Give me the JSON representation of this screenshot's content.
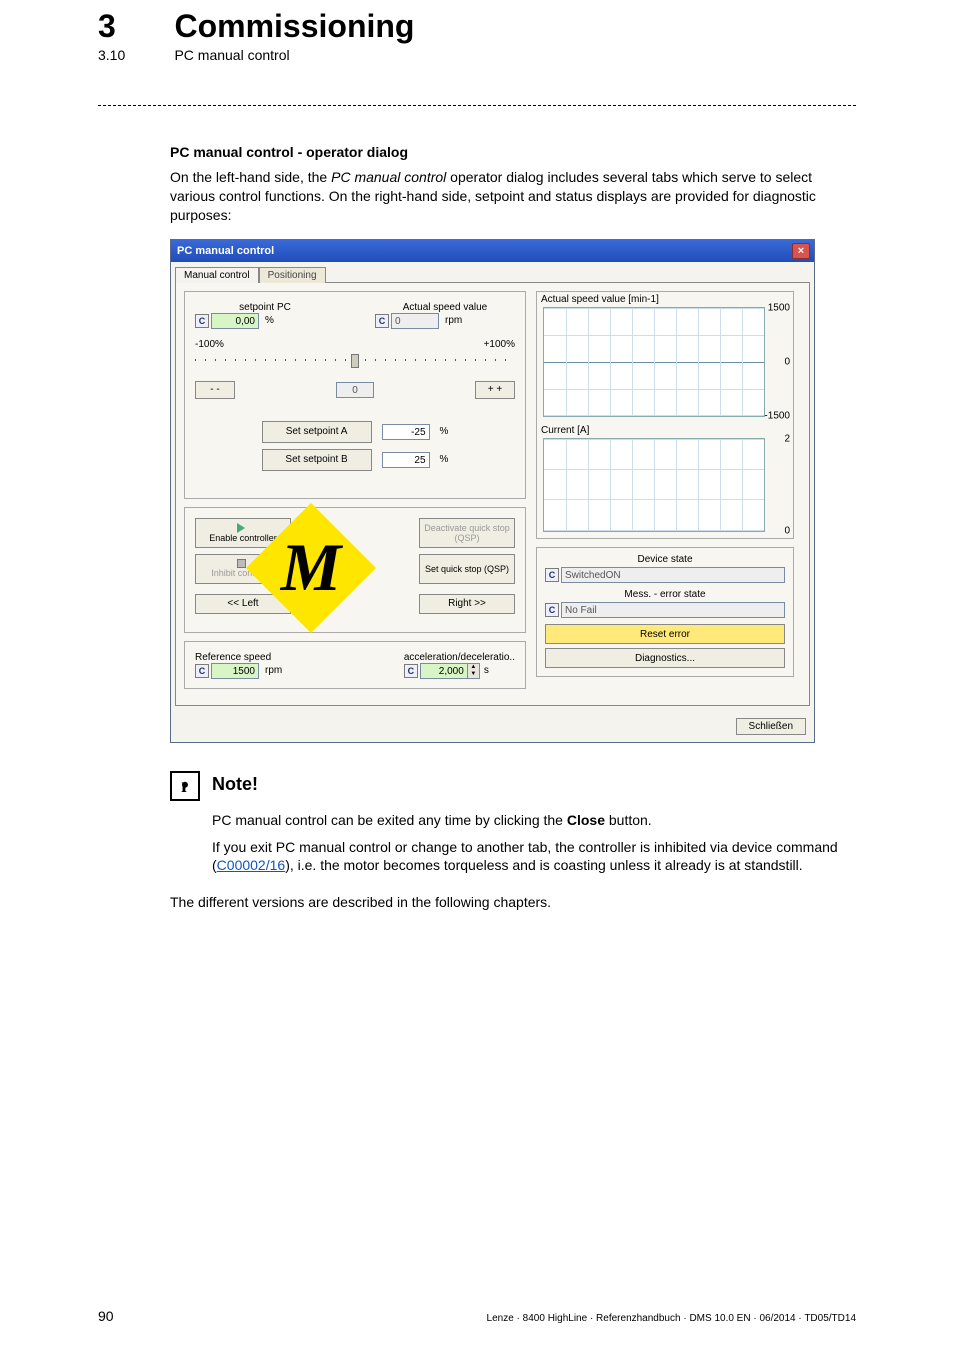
{
  "header": {
    "chapter_number": "3",
    "chapter_title": "Commissioning",
    "section_number": "3.10",
    "section_title": "PC manual control"
  },
  "intro": {
    "heading": "PC manual control - operator dialog",
    "para_pre": "On the left-hand side, the ",
    "para_em": "PC manual control",
    "para_post": " operator dialog includes several tabs which serve to select various control functions. On the right-hand side, setpoint and status displays are provided for diagnostic purposes:"
  },
  "dialog": {
    "title": "PC manual control",
    "close_x": "×",
    "tabs": {
      "active": "Manual control",
      "inactive": "Positioning"
    },
    "left": {
      "setpoint_pc_label": "setpoint PC",
      "setpoint_pc_value": "0,00",
      "setpoint_pc_unit": "%",
      "actual_speed_label": "Actual speed value",
      "actual_speed_value": "0",
      "actual_speed_unit": "rpm",
      "slider_min": "-100%",
      "slider_max": "+100%",
      "btn_minus": "- -",
      "btn_plus": "+ +",
      "slider_val": "0",
      "set_a_label": "Set setpoint A",
      "set_a_value": "-25",
      "set_a_unit": "%",
      "set_b_label": "Set setpoint B",
      "set_b_value": "25",
      "set_b_unit": "%",
      "enable_ctrl": "Enable controller",
      "deact_qsp": "Deactivate quick stop (QSP)",
      "inhibit_ctrl": "Inhibit controller",
      "set_qsp": "Set quick stop (QSP)",
      "left_btn": "<< Left",
      "right_btn": "Right >>",
      "ref_speed_label": "Reference speed",
      "ref_speed_value": "1500",
      "ref_speed_unit": "rpm",
      "accel_label": "acceleration/deceleratio..",
      "accel_value": "2,000",
      "accel_unit": "s"
    },
    "right": {
      "plot1_title": "Actual speed value [min-1]",
      "plot1_ticks": {
        "top": "1500",
        "mid": "0",
        "bot": "-1500"
      },
      "plot2_title": "Current [A]",
      "plot2_ticks": {
        "top": "2",
        "bot": "0"
      },
      "devstate_label": "Device state",
      "devstate_value": "SwitchedON",
      "errstate_label": "Mess. - error state",
      "errstate_value": "No Fail",
      "reset_error": "Reset error",
      "diagnostics": "Diagnostics..."
    },
    "close_button": "Schließen"
  },
  "note": {
    "heading": "Note!",
    "line1_pre": "PC manual control can be exited any time by clicking the ",
    "line1_bold": "Close",
    "line1_post": " button.",
    "line2_pre": "If you exit PC manual control or change to another tab, the controller is inhibited via device command (",
    "line2_link": "C00002/16",
    "line2_post": "), i.e. the motor becomes torqueless and is coasting unless it already is at standstill."
  },
  "outro": "The different versions are described in the following chapters.",
  "footer": {
    "page": "90",
    "right": "Lenze · 8400 HighLine · Referenzhandbuch · DMS 10.0 EN · 06/2014 · TD05/TD14"
  },
  "c_badge": "C"
}
